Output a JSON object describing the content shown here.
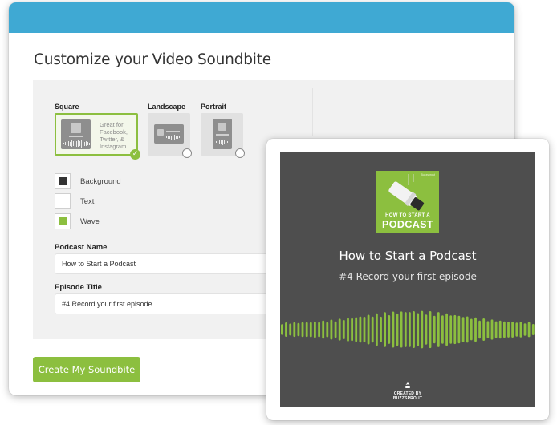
{
  "page": {
    "title": "Customize your Video Soundbite"
  },
  "formats": [
    {
      "label": "Square",
      "description": "Great for Facebook, Twitter, & Instagram.",
      "selected": true
    },
    {
      "label": "Landscape",
      "selected": false
    },
    {
      "label": "Portrait",
      "selected": false
    }
  ],
  "colors": [
    {
      "label": "Background",
      "value": "#333333"
    },
    {
      "label": "Text",
      "value": "#ffffff"
    },
    {
      "label": "Wave",
      "value": "#8cbf3f"
    }
  ],
  "fields": {
    "podcast_name": {
      "label": "Podcast Name",
      "value": "How to Start a Podcast"
    },
    "episode_title": {
      "label": "Episode Title",
      "value": "#4 Record your first episode"
    }
  },
  "actions": {
    "create_label": "Create My Soundbite"
  },
  "preview": {
    "artwork_line1": "HOW TO START A",
    "artwork_line2": "PODCAST",
    "artwork_brand": "Buzzsprout",
    "title": "How to Start a Podcast",
    "subtitle": "#4 Record your first episode",
    "credit_line1": "CREATED BY",
    "credit_line2": "BUZZSPROUT"
  },
  "theme": {
    "accent": "#8cbf3f",
    "header": "#3fa9d3",
    "preview_bg": "#4e4e4e"
  }
}
